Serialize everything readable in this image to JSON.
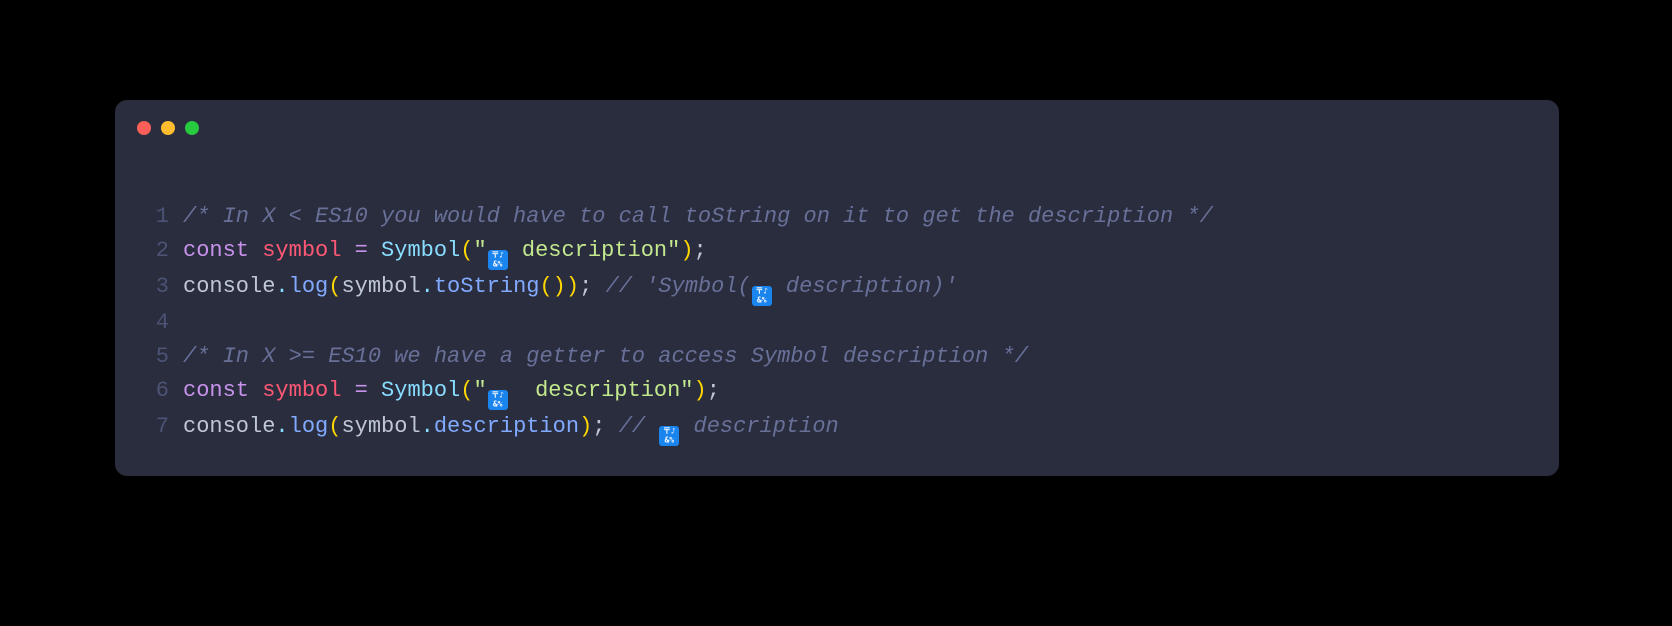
{
  "editor": {
    "lines": [
      {
        "number": "1",
        "tokens": [
          {
            "cls": "tok-comment",
            "text": "/* In X < ES10 you would have to call toString on it to get the description */"
          }
        ]
      },
      {
        "number": "2",
        "tokens": [
          {
            "cls": "tok-keyword",
            "text": "const"
          },
          {
            "cls": "tok-ident",
            "text": " "
          },
          {
            "cls": "tok-var",
            "text": "symbol"
          },
          {
            "cls": "tok-ident",
            "text": " "
          },
          {
            "cls": "tok-operator",
            "text": "="
          },
          {
            "cls": "tok-ident",
            "text": " "
          },
          {
            "cls": "tok-func",
            "text": "Symbol"
          },
          {
            "cls": "tok-paren",
            "text": "("
          },
          {
            "cls": "tok-string",
            "text": "\""
          },
          {
            "cls": "emoji",
            "text": "🔣"
          },
          {
            "cls": "tok-string",
            "text": " description\""
          },
          {
            "cls": "tok-paren",
            "text": ")"
          },
          {
            "cls": "tok-semi",
            "text": ";"
          }
        ]
      },
      {
        "number": "3",
        "tokens": [
          {
            "cls": "tok-ident",
            "text": "console"
          },
          {
            "cls": "tok-dot",
            "text": "."
          },
          {
            "cls": "tok-method",
            "text": "log"
          },
          {
            "cls": "tok-paren",
            "text": "("
          },
          {
            "cls": "tok-ident",
            "text": "symbol"
          },
          {
            "cls": "tok-dot",
            "text": "."
          },
          {
            "cls": "tok-prop",
            "text": "toString"
          },
          {
            "cls": "tok-paren",
            "text": "()"
          },
          {
            "cls": "tok-paren",
            "text": ")"
          },
          {
            "cls": "tok-semi",
            "text": ";"
          },
          {
            "cls": "tok-ident",
            "text": " "
          },
          {
            "cls": "tok-comment",
            "text": "// 'Symbol("
          },
          {
            "cls": "emoji-comment",
            "text": "🔣"
          },
          {
            "cls": "tok-comment",
            "text": " description)'"
          }
        ]
      },
      {
        "number": "4",
        "tokens": []
      },
      {
        "number": "5",
        "tokens": [
          {
            "cls": "tok-comment",
            "text": "/* In X >= ES10 we have a getter to access Symbol description */"
          }
        ]
      },
      {
        "number": "6",
        "tokens": [
          {
            "cls": "tok-keyword",
            "text": "const"
          },
          {
            "cls": "tok-ident",
            "text": " "
          },
          {
            "cls": "tok-var",
            "text": "symbol"
          },
          {
            "cls": "tok-ident",
            "text": " "
          },
          {
            "cls": "tok-operator",
            "text": "="
          },
          {
            "cls": "tok-ident",
            "text": " "
          },
          {
            "cls": "tok-func",
            "text": "Symbol"
          },
          {
            "cls": "tok-paren",
            "text": "("
          },
          {
            "cls": "tok-string",
            "text": "\""
          },
          {
            "cls": "emoji",
            "text": "🔣"
          },
          {
            "cls": "tok-string",
            "text": "  description\""
          },
          {
            "cls": "tok-paren",
            "text": ")"
          },
          {
            "cls": "tok-semi",
            "text": ";"
          }
        ]
      },
      {
        "number": "7",
        "tokens": [
          {
            "cls": "tok-ident",
            "text": "console"
          },
          {
            "cls": "tok-dot",
            "text": "."
          },
          {
            "cls": "tok-method",
            "text": "log"
          },
          {
            "cls": "tok-paren",
            "text": "("
          },
          {
            "cls": "tok-ident",
            "text": "symbol"
          },
          {
            "cls": "tok-dot",
            "text": "."
          },
          {
            "cls": "tok-prop",
            "text": "description"
          },
          {
            "cls": "tok-paren",
            "text": ")"
          },
          {
            "cls": "tok-semi",
            "text": ";"
          },
          {
            "cls": "tok-ident",
            "text": " "
          },
          {
            "cls": "tok-comment",
            "text": "// "
          },
          {
            "cls": "emoji-comment",
            "text": "🔣"
          },
          {
            "cls": "tok-comment",
            "text": " description"
          }
        ]
      }
    ]
  }
}
